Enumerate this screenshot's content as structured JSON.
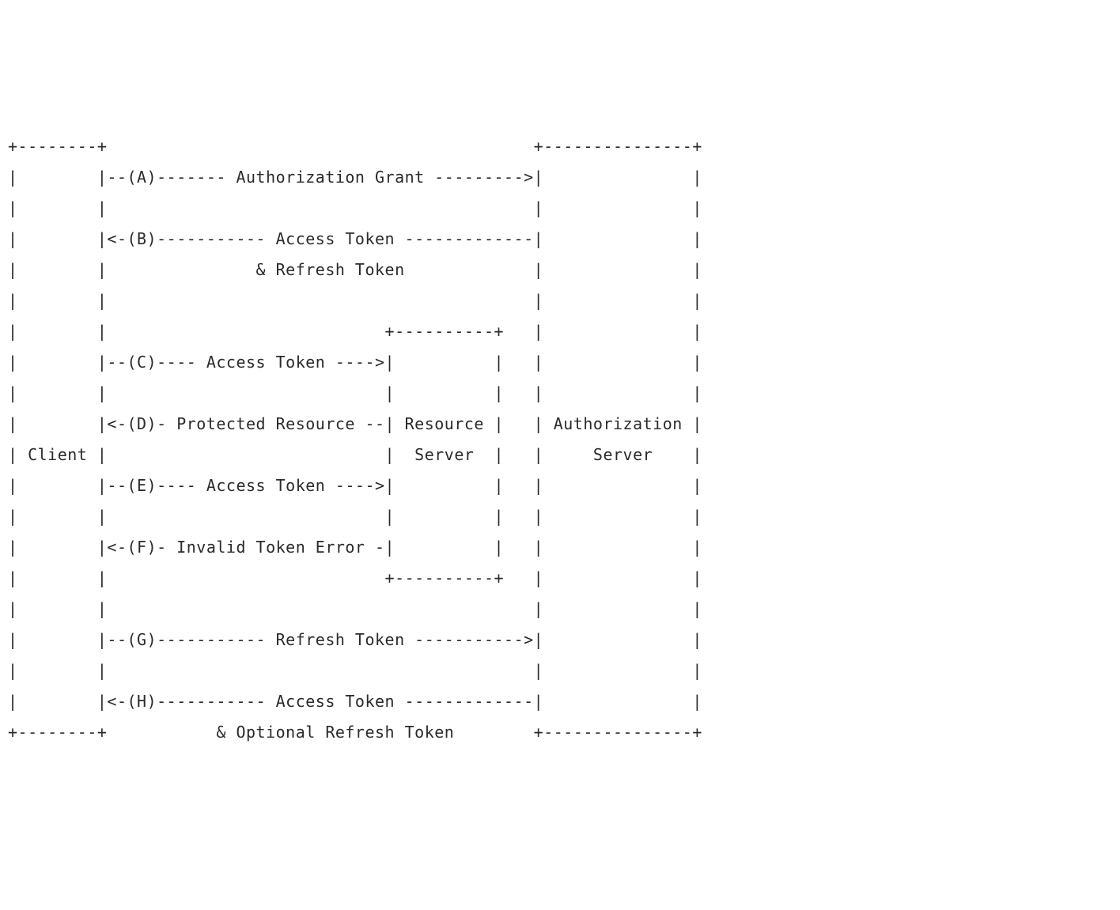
{
  "diagram": {
    "entities": {
      "client": "Client",
      "resource_server_line1": "Resource",
      "resource_server_line2": "Server",
      "authorization_server_line1": "Authorization",
      "authorization_server_line2": "Server"
    },
    "flows": {
      "A": {
        "dir": "-->",
        "label": "Authorization Grant",
        "from": "Client",
        "to": "Authorization Server"
      },
      "B": {
        "dir": "<--",
        "label": "Access Token",
        "sub": "& Refresh Token",
        "from": "Authorization Server",
        "to": "Client"
      },
      "C": {
        "dir": "-->",
        "label": "Access Token",
        "from": "Client",
        "to": "Resource Server"
      },
      "D": {
        "dir": "<--",
        "label": "Protected Resource",
        "from": "Resource Server",
        "to": "Client"
      },
      "E": {
        "dir": "-->",
        "label": "Access Token",
        "from": "Client",
        "to": "Resource Server"
      },
      "F": {
        "dir": "<--",
        "label": "Invalid Token Error",
        "from": "Resource Server",
        "to": "Client"
      },
      "G": {
        "dir": "-->",
        "label": "Refresh Token",
        "from": "Client",
        "to": "Authorization Server"
      },
      "H": {
        "dir": "<--",
        "label": "Access Token",
        "sub": "& Optional Refresh Token",
        "from": "Authorization Server",
        "to": "Client"
      }
    },
    "lines": [
      "+--------+                                           +---------------+",
      "|        |--(A)------- Authorization Grant --------->|               |",
      "|        |                                           |               |",
      "|        |<-(B)----------- Access Token -------------|               |",
      "|        |               & Refresh Token             |               |",
      "|        |                                           |               |",
      "|        |                            +----------+   |               |",
      "|        |--(C)---- Access Token ---->|          |   |               |",
      "|        |                            |          |   |               |",
      "|        |<-(D)- Protected Resource --| Resource |   | Authorization |",
      "| Client |                            |  Server  |   |     Server    |",
      "|        |--(E)---- Access Token ---->|          |   |               |",
      "|        |                            |          |   |               |",
      "|        |<-(F)- Invalid Token Error -|          |   |               |",
      "|        |                            +----------+   |               |",
      "|        |                                           |               |",
      "|        |--(G)----------- Refresh Token ----------->|               |",
      "|        |                                           |               |",
      "|        |<-(H)----------- Access Token -------------|               |",
      "+--------+           & Optional Refresh Token        +---------------+"
    ]
  }
}
